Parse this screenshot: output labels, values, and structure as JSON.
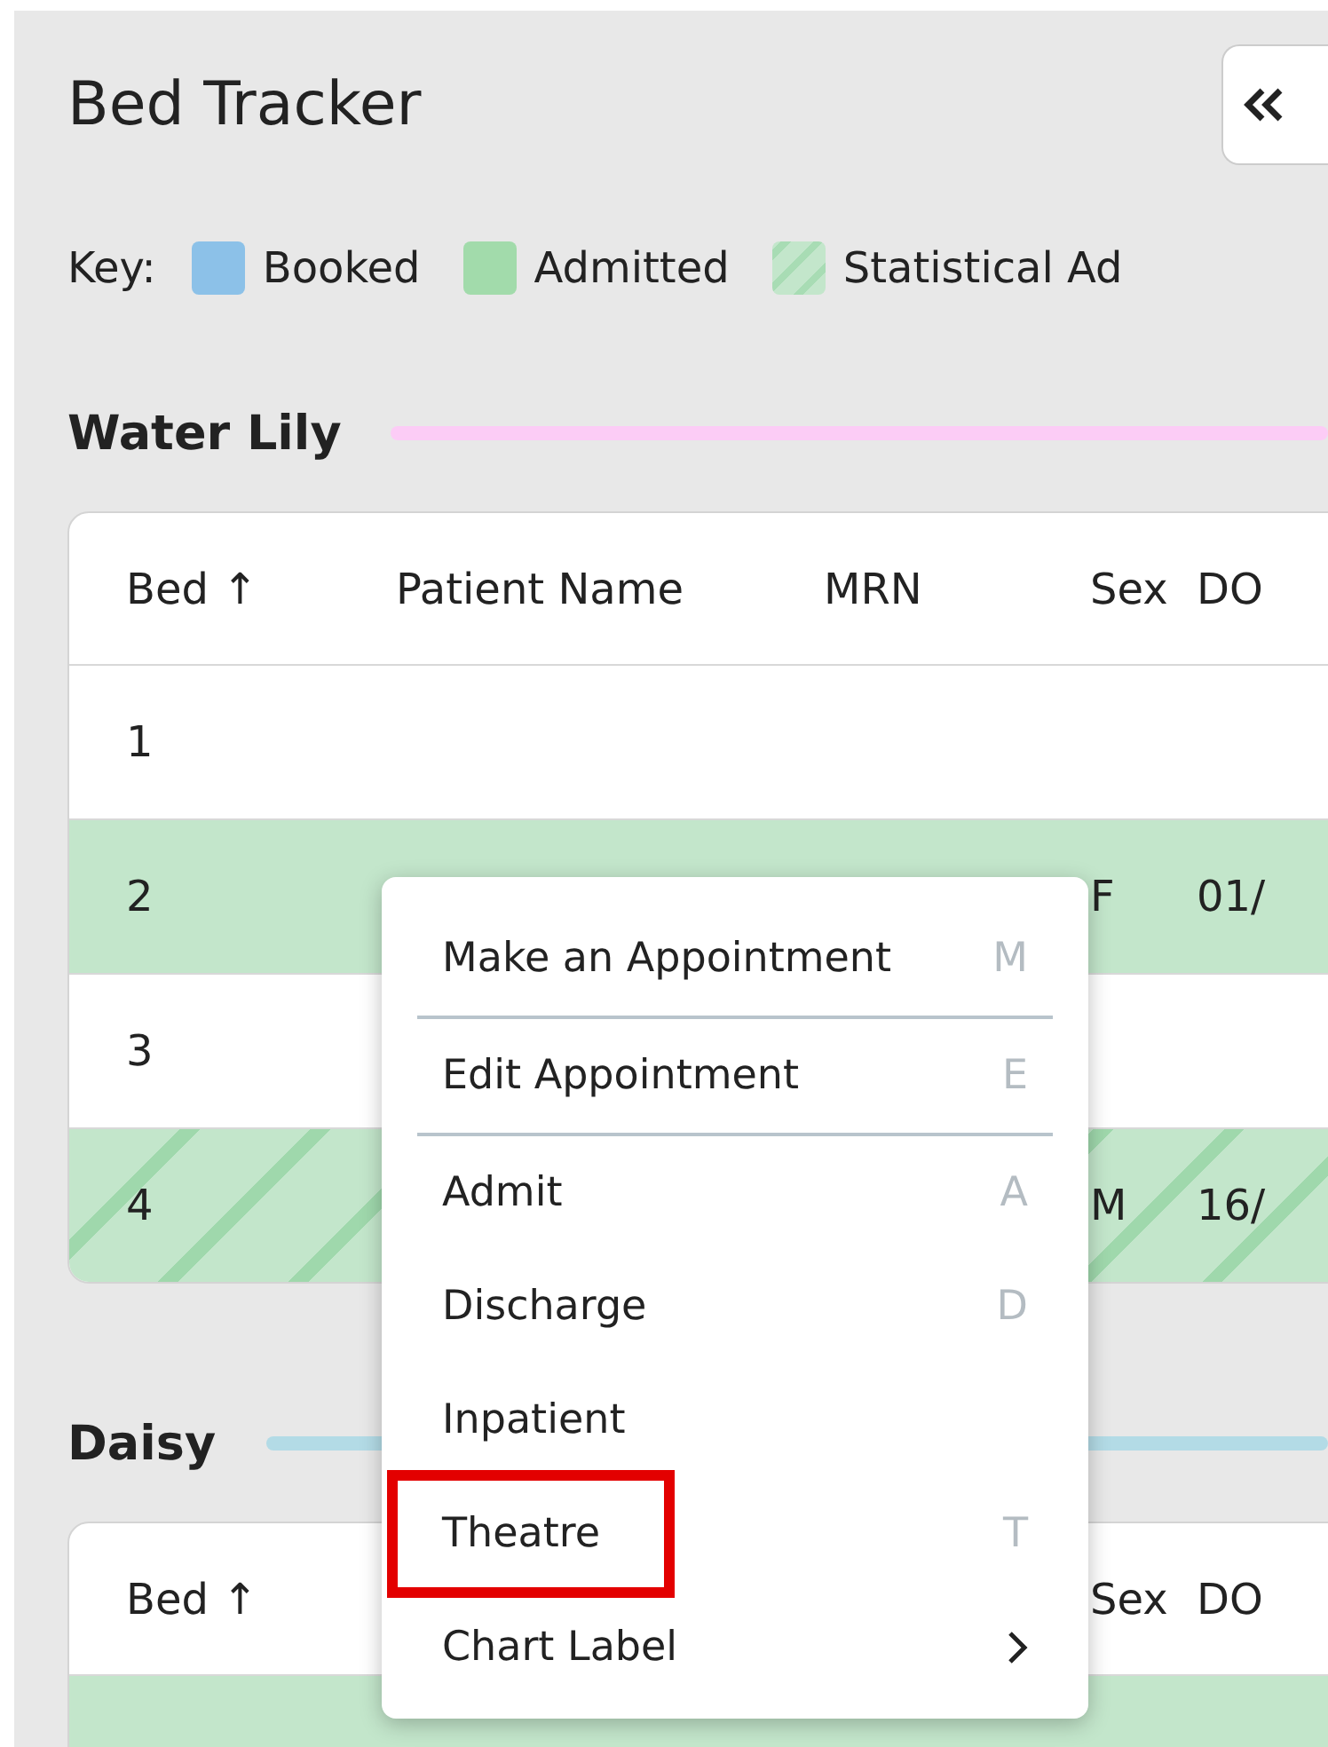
{
  "title": "Bed Tracker",
  "key": {
    "label": "Key:",
    "items": [
      {
        "kind": "booked",
        "label": "Booked"
      },
      {
        "kind": "admitted",
        "label": "Admitted"
      },
      {
        "kind": "statistical",
        "label": "Statistical Ad"
      }
    ]
  },
  "wards": [
    {
      "name": "Water Lily",
      "color": "#fcccf6",
      "columns": [
        "Bed ↑",
        "Patient Name",
        "MRN",
        "Sex",
        "DO"
      ],
      "rows": [
        {
          "kind": "empty",
          "cells": [
            "1",
            "",
            "",
            "",
            ""
          ]
        },
        {
          "kind": "admitted",
          "cells": [
            "2",
            "",
            "",
            "F",
            "01/"
          ]
        },
        {
          "kind": "empty",
          "cells": [
            "3",
            "",
            "",
            "",
            ""
          ]
        },
        {
          "kind": "statistical",
          "cells": [
            "4",
            "",
            "",
            "M",
            "16/"
          ]
        }
      ]
    },
    {
      "name": "Daisy",
      "color": "#b3dbe6",
      "columns": [
        "Bed ↑",
        "",
        "",
        "Sex",
        "DO"
      ],
      "rows": [
        {
          "kind": "admitted"
        }
      ]
    }
  ],
  "context_menu": {
    "items": [
      {
        "label": "Make an Appointment",
        "shortcut": "M",
        "divider_after": true,
        "highlighted": false
      },
      {
        "label": "Edit Appointment",
        "shortcut": "E",
        "divider_after": true,
        "highlighted": false
      },
      {
        "label": "Admit",
        "shortcut": "A",
        "divider_after": false,
        "highlighted": false
      },
      {
        "label": "Discharge",
        "shortcut": "D",
        "divider_after": false,
        "highlighted": false
      },
      {
        "label": "Inpatient",
        "divider_after": false,
        "highlighted": false
      },
      {
        "label": "Theatre",
        "shortcut": "T",
        "divider_after": false,
        "highlighted": true
      },
      {
        "label": "Chart Label",
        "submenu": true,
        "divider_after": false,
        "highlighted": false
      }
    ]
  }
}
